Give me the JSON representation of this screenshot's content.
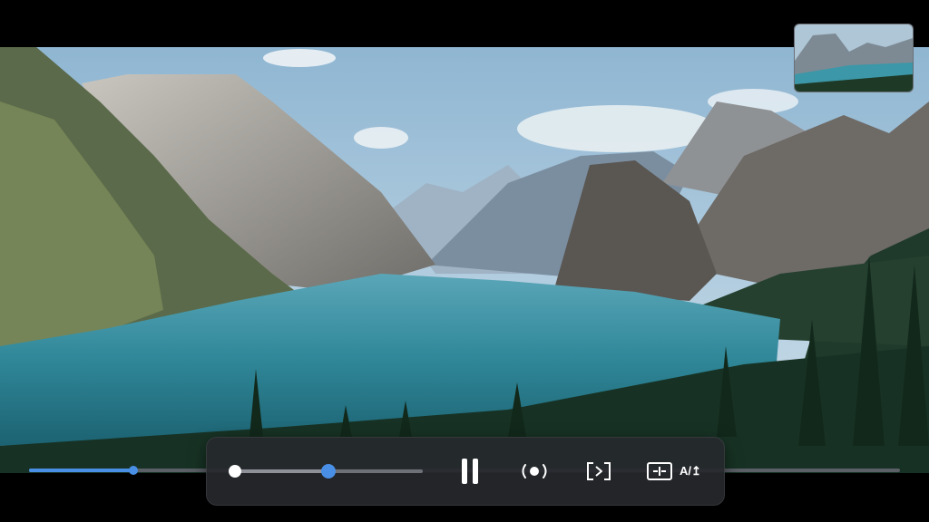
{
  "player": {
    "progress_fraction": 0.12,
    "scrubber_fraction": 0.5
  },
  "controls": {
    "subtitle_label": "A/↥"
  },
  "icons": {
    "pause": "pause-icon",
    "broadcast": "broadcast-icon",
    "cast": "cast-icon",
    "audio_track": "audio-track-icon",
    "subtitles": "subtitles-icon"
  },
  "colors": {
    "accent": "#4a8fe6",
    "control_bar": "#26282c"
  }
}
